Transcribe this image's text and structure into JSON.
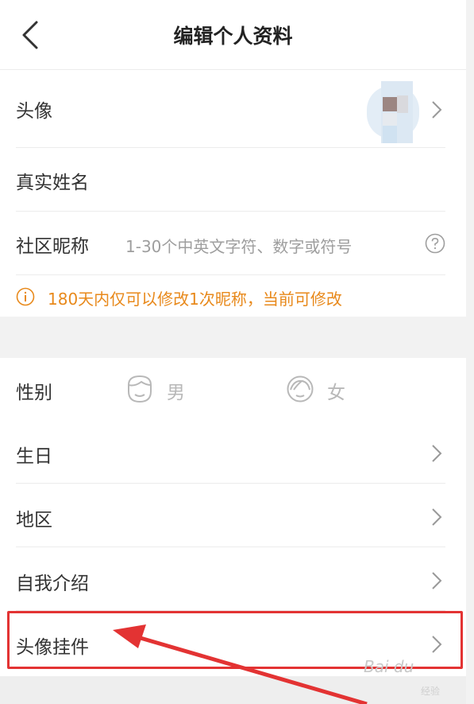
{
  "header": {
    "title": "编辑个人资料"
  },
  "profile": {
    "avatar_label": "头像",
    "real_name_label": "真实姓名",
    "nickname_label": "社区昵称",
    "nickname_placeholder": "1-30个中英文字符、数字或符号",
    "notice_text": "180天内仅可以修改1次昵称，当前可修改"
  },
  "details": {
    "gender_label": "性别",
    "gender_male": "男",
    "gender_female": "女",
    "birthday_label": "生日",
    "region_label": "地区",
    "intro_label": "自我介绍",
    "avatar_pendant_label": "头像挂件"
  },
  "watermark": {
    "text": "Bai du",
    "sub": "经验"
  },
  "colors": {
    "accent_orange": "#e8891b",
    "highlight_red": "#e33333"
  }
}
